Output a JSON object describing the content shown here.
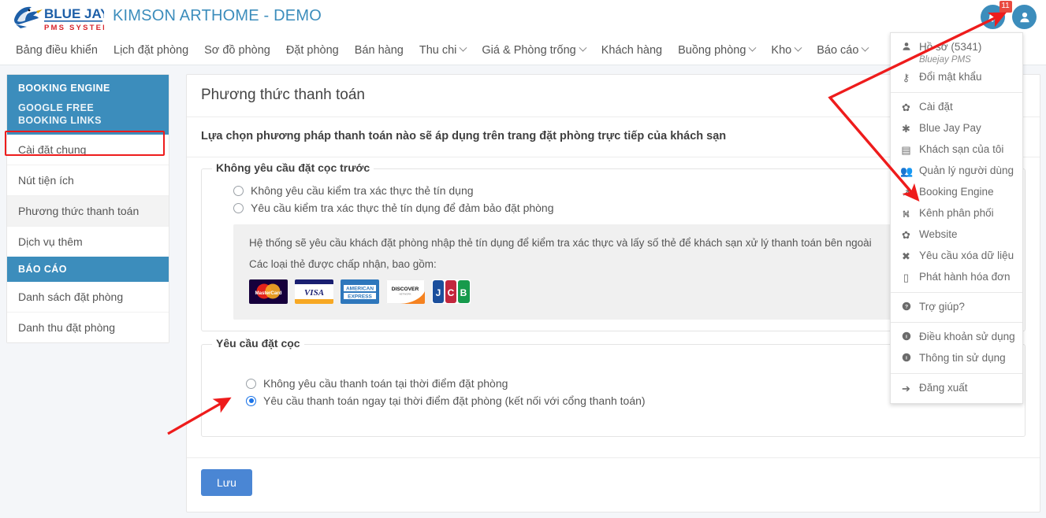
{
  "header": {
    "brand_logo_text": "BLUE JAY",
    "brand_logo_sub": "PMS SYSTEM",
    "title": "KIMSON ARTHOME - DEMO",
    "bell_badge": "11",
    "bell_icon": "bell-icon",
    "avatar_icon": "user-avatar-icon"
  },
  "nav": {
    "items": [
      {
        "label": "Bảng điều khiển",
        "caret": false
      },
      {
        "label": "Lịch đặt phòng",
        "caret": false
      },
      {
        "label": "Sơ đồ phòng",
        "caret": false
      },
      {
        "label": "Đặt phòng",
        "caret": false
      },
      {
        "label": "Bán hàng",
        "caret": false
      },
      {
        "label": "Thu chi",
        "caret": true
      },
      {
        "label": "Giá & Phòng trống",
        "caret": true
      },
      {
        "label": "Khách hàng",
        "caret": false
      },
      {
        "label": "Buồng phòng",
        "caret": true
      },
      {
        "label": "Kho",
        "caret": true
      },
      {
        "label": "Báo cáo",
        "caret": true
      }
    ]
  },
  "sidebar": {
    "section1_title": "BOOKING ENGINE",
    "section1_subtitle": "GOOGLE FREE\nBOOKING LINKS",
    "section1_items": [
      "Cài đặt chung",
      "Nút tiện ích",
      "Phương thức thanh toán",
      "Dịch vụ thêm"
    ],
    "active_item": "Phương thức thanh toán",
    "section2_title": "BÁO CÁO",
    "section2_items": [
      "Danh sách đặt phòng",
      "Danh thu đặt phòng"
    ]
  },
  "main": {
    "title": "Phương thức thanh toán",
    "subtitle": "Lựa chọn phương pháp thanh toán nào sẽ áp dụng trên trang đặt phòng trực tiếp của khách sạn",
    "group_no_deposit": {
      "legend": "Không yêu cầu đặt cọc trước",
      "options": [
        {
          "label": "Không yêu cầu kiểm tra xác thực thẻ tín dụng",
          "selected": false
        },
        {
          "label": "Yêu cầu kiểm tra xác thực thẻ tín dụng để đảm bảo đặt phòng",
          "selected": false
        }
      ],
      "info_text": "Hệ thống sẽ yêu cầu khách đặt phòng nhập thẻ tín dụng để kiểm tra xác thực và lấy số thẻ để khách sạn xử lý thanh toán bên ngoài",
      "cards_label": "Các loại thẻ được chấp nhận, bao gồm:",
      "cards": [
        "MasterCard",
        "VISA",
        "AMERICAN EXPRESS",
        "DISCOVER",
        "JCB"
      ]
    },
    "group_deposit": {
      "legend": "Yêu cầu đặt cọc",
      "options": [
        {
          "label": "Không yêu cầu thanh toán tại thời điểm đặt phòng",
          "selected": false
        },
        {
          "label": "Yêu cầu thanh toán ngay tại thời điểm đặt phòng (kết nối với cổng thanh toán)",
          "selected": true
        }
      ]
    },
    "save_label": "Lưu"
  },
  "dropdown": {
    "profile": {
      "label": "Hồ sơ (5341)",
      "icon": "user-icon",
      "subtitle": "Bluejay PMS"
    },
    "groups": [
      [
        {
          "label": "Đổi mật khẩu",
          "icon": "key-icon"
        }
      ],
      [
        {
          "label": "Cài đặt",
          "icon": "gear-icon"
        },
        {
          "label": "Blue Jay Pay",
          "icon": "asterisk-icon"
        },
        {
          "label": "Khách sạn của tôi",
          "icon": "building-icon"
        },
        {
          "label": "Quản lý người dùng",
          "icon": "users-icon"
        },
        {
          "label": "Booking Engine",
          "icon": "external-link-icon"
        },
        {
          "label": "Kênh phân phối",
          "icon": "sitemap-icon"
        },
        {
          "label": "Website",
          "icon": "gear-icon"
        },
        {
          "label": "Yêu cầu xóa dữ liệu",
          "icon": "close-x-icon"
        },
        {
          "label": "Phát hành hóa đơn",
          "icon": "file-icon"
        }
      ],
      [
        {
          "label": "Trợ giúp?",
          "icon": "question-circle-icon"
        }
      ],
      [
        {
          "label": "Điều khoản sử dụng",
          "icon": "info-circle-icon"
        },
        {
          "label": "Thông tin sử dụng",
          "icon": "info-circle-icon"
        }
      ],
      [
        {
          "label": "Đăng xuất",
          "icon": "sign-out-icon"
        }
      ]
    ]
  },
  "annotations": {
    "highlight_color": "#ee1c1c",
    "arrow_color": "#ee1c1c"
  },
  "colors": {
    "brand_blue": "#3c8dbc",
    "accent_blue": "#4a86d4",
    "badge_red": "#e94a3f",
    "radio_blue": "#1a73e8"
  }
}
